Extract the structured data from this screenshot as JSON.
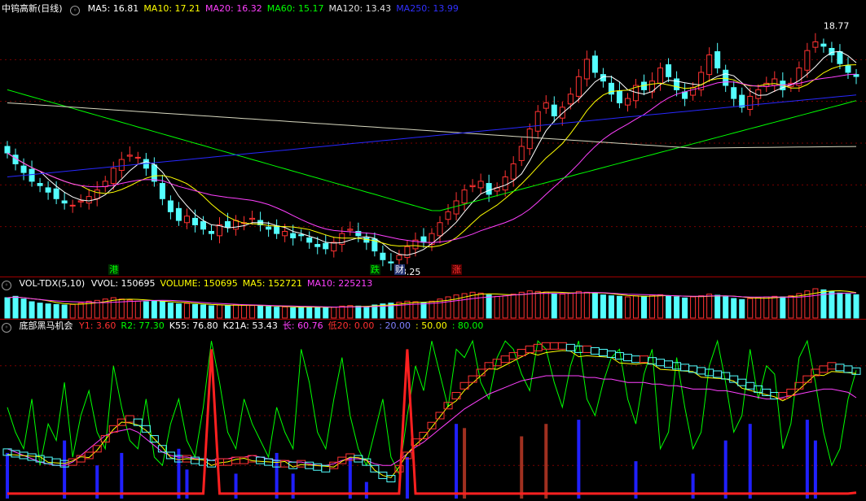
{
  "main": {
    "title": "中钨高新(日线)",
    "ma": [
      {
        "label": "MA5: 16.81",
        "color": "#ffffff"
      },
      {
        "label": "MA10: 17.21",
        "color": "#ffff00"
      },
      {
        "label": "MA20: 16.32",
        "color": "#ff40ff"
      },
      {
        "label": "MA60: 15.17",
        "color": "#00ff00"
      },
      {
        "label": "MA120: 13.43",
        "color": "#e0e0e0"
      },
      {
        "label": "MA250: 13.99",
        "color": "#3030ff"
      }
    ],
    "high_label": "18.77",
    "low_label": "8.25",
    "tags": [
      {
        "text": "港",
        "color": "#00ff00",
        "bg": "#003000"
      },
      {
        "text": "跌",
        "color": "#00ff00",
        "bg": "#003000"
      },
      {
        "text": "财",
        "color": "#ffffff",
        "bg": "#203070"
      },
      {
        "text": "涨",
        "color": "#ff3030",
        "bg": "#500000"
      }
    ]
  },
  "volume": {
    "label": "VOL-TDX(5,10)",
    "items": [
      {
        "label": "VVOL: 150695",
        "color": "#ffffff"
      },
      {
        "label": "VOLUME: 150695",
        "color": "#ffff00"
      },
      {
        "label": "MA5: 152721",
        "color": "#ffff00"
      },
      {
        "label": "MA10: 225213",
        "color": "#ff40ff"
      }
    ]
  },
  "indicator": {
    "name": "底部黑马机会",
    "items": [
      {
        "label": "Y1: 3.60",
        "color": "#ff3030"
      },
      {
        "label": "R2: 77.30",
        "color": "#00ff00"
      },
      {
        "label": "K55: 76.80",
        "color": "#ffffff"
      },
      {
        "label": "K21A: 53.43",
        "color": "#ffffff"
      },
      {
        "label": "长: 60.76",
        "color": "#ff40ff"
      },
      {
        "label": "低20: 0.00",
        "color": "#ff3030"
      },
      {
        "label": ": 20.00",
        "color": "#8080ff"
      },
      {
        "label": ": 50.00",
        "color": "#ffff00"
      },
      {
        "label": ": 80.00",
        "color": "#00ff00"
      }
    ]
  },
  "chart_data": {
    "type": "candlestick",
    "close": [
      13.3,
      12.8,
      12.4,
      12.0,
      11.8,
      11.5,
      11.2,
      11.0,
      10.9,
      11.1,
      11.3,
      11.6,
      12.0,
      12.6,
      13.0,
      13.2,
      13.1,
      12.6,
      12.0,
      11.2,
      10.6,
      10.2,
      10.4,
      10.0,
      9.8,
      9.6,
      10.0,
      9.9,
      10.2,
      10.1,
      10.3,
      10.0,
      9.8,
      9.6,
      9.7,
      9.4,
      9.5,
      9.2,
      9.0,
      8.9,
      9.2,
      9.6,
      9.8,
      9.5,
      9.2,
      8.8,
      8.4,
      8.25,
      8.6,
      9.0,
      9.3,
      9.2,
      9.6,
      10.1,
      10.6,
      11.1,
      11.6,
      11.8,
      12.0,
      11.4,
      11.7,
      12.2,
      12.8,
      13.6,
      14.4,
      15.2,
      15.6,
      15.0,
      15.4,
      16.0,
      16.8,
      17.6,
      17.0,
      16.6,
      16.0,
      15.6,
      15.8,
      16.4,
      16.2,
      16.6,
      17.2,
      16.8,
      16.2,
      15.8,
      16.3,
      17.0,
      17.8,
      17.2,
      16.4,
      15.8,
      15.4,
      15.9,
      16.2,
      16.5,
      16.7,
      16.2,
      16.5,
      17.2,
      18.0,
      18.4,
      18.2,
      17.8,
      17.4,
      17.0,
      16.81
    ],
    "volume": [
      75,
      80,
      70,
      60,
      55,
      52,
      50,
      48,
      50,
      55,
      62,
      65,
      70,
      75,
      70,
      66,
      62,
      60,
      64,
      60,
      55,
      52,
      54,
      50,
      48,
      45,
      48,
      46,
      48,
      47,
      46,
      44,
      42,
      40,
      41,
      38,
      40,
      42,
      40,
      38,
      40,
      44,
      46,
      44,
      42,
      48,
      52,
      55,
      58,
      62,
      60,
      56,
      62,
      70,
      78,
      85,
      90,
      95,
      92,
      85,
      80,
      82,
      88,
      95,
      100,
      98,
      96,
      90,
      88,
      92,
      98,
      95,
      90,
      85,
      82,
      80,
      78,
      82,
      80,
      84,
      86,
      82,
      78,
      74,
      78,
      82,
      88,
      84,
      78,
      72,
      68,
      72,
      76,
      78,
      80,
      78,
      82,
      90,
      100,
      108,
      104,
      98,
      92,
      88,
      86
    ],
    "k55": [
      28,
      27,
      26,
      25,
      24,
      23,
      22,
      21,
      22,
      24,
      26,
      30,
      36,
      42,
      46,
      48,
      46,
      42,
      36,
      30,
      26,
      24,
      24,
      23,
      22,
      21,
      22,
      22,
      23,
      23,
      24,
      23,
      22,
      21,
      21,
      20,
      21,
      20,
      19,
      18,
      20,
      23,
      25,
      24,
      22,
      18,
      14,
      12,
      18,
      26,
      34,
      38,
      44,
      50,
      56,
      62,
      68,
      72,
      76,
      80,
      82,
      84,
      86,
      88,
      90,
      91,
      92,
      92,
      92,
      91,
      90,
      90,
      89,
      88,
      87,
      86,
      85,
      84,
      84,
      83,
      82,
      81,
      80,
      79,
      78,
      77,
      76,
      75,
      74,
      72,
      70,
      68,
      66,
      64,
      62,
      62,
      64,
      68,
      72,
      76,
      78,
      80,
      79,
      78,
      76.8
    ],
    "k21a": [
      30,
      28,
      26,
      24,
      22,
      21,
      20,
      20,
      22,
      26,
      30,
      34,
      38,
      40,
      41,
      42,
      40,
      36,
      32,
      28,
      26,
      25,
      25,
      24,
      24,
      23,
      24,
      24,
      25,
      25,
      26,
      25,
      24,
      23,
      23,
      22,
      22,
      21,
      20,
      20,
      21,
      23,
      24,
      24,
      23,
      21,
      20,
      20,
      23,
      27,
      31,
      34,
      38,
      42,
      46,
      50,
      54,
      57,
      60,
      63,
      65,
      67,
      69,
      71,
      72,
      73,
      74,
      74,
      74,
      74,
      74,
      73,
      73,
      72,
      72,
      71,
      70,
      70,
      70,
      69,
      69,
      68,
      68,
      67,
      66,
      66,
      66,
      65,
      65,
      64,
      63,
      62,
      61,
      60,
      60,
      61,
      62,
      63,
      64,
      65,
      66,
      66,
      65,
      64,
      60.76
    ],
    "r2": [
      55,
      40,
      30,
      60,
      20,
      45,
      35,
      70,
      25,
      50,
      65,
      40,
      30,
      80,
      55,
      35,
      30,
      60,
      25,
      20,
      45,
      60,
      35,
      25,
      55,
      95,
      70,
      40,
      30,
      60,
      45,
      35,
      25,
      55,
      40,
      30,
      90,
      70,
      40,
      30,
      60,
      85,
      50,
      30,
      20,
      40,
      60,
      25,
      15,
      50,
      80,
      65,
      95,
      75,
      55,
      90,
      85,
      95,
      70,
      60,
      85,
      95,
      90,
      75,
      65,
      95,
      90,
      70,
      55,
      80,
      95,
      60,
      50,
      70,
      85,
      90,
      60,
      45,
      75,
      90,
      30,
      40,
      85,
      55,
      30,
      40,
      80,
      95,
      70,
      40,
      50,
      90,
      60,
      80,
      75,
      30,
      45,
      85,
      95,
      70,
      40,
      20,
      30,
      60,
      77.3
    ],
    "y1": [
      3,
      3,
      3,
      3,
      3,
      3,
      3,
      3,
      3,
      3,
      3,
      3,
      3,
      3,
      3,
      3,
      3,
      3,
      3,
      3,
      3,
      3,
      3,
      3,
      3,
      90,
      3,
      3,
      3,
      3,
      3,
      3,
      3,
      3,
      3,
      3,
      3,
      3,
      3,
      3,
      3,
      3,
      3,
      3,
      3,
      3,
      3,
      3,
      3,
      90,
      3,
      3,
      3,
      3,
      3,
      3,
      3,
      3,
      3,
      3,
      3,
      3,
      3,
      3,
      3,
      3,
      3,
      3,
      3,
      3,
      3,
      3,
      3,
      3,
      3,
      3,
      3,
      3,
      3,
      3,
      3,
      3,
      3,
      3,
      3,
      3,
      3,
      3,
      3,
      3,
      3,
      3,
      3,
      3,
      3,
      3,
      3,
      3,
      3,
      3,
      3,
      3,
      3,
      3,
      3.6
    ],
    "ylim": [
      8.0,
      19.5
    ],
    "indicator_lines": [
      20,
      50,
      80
    ]
  }
}
